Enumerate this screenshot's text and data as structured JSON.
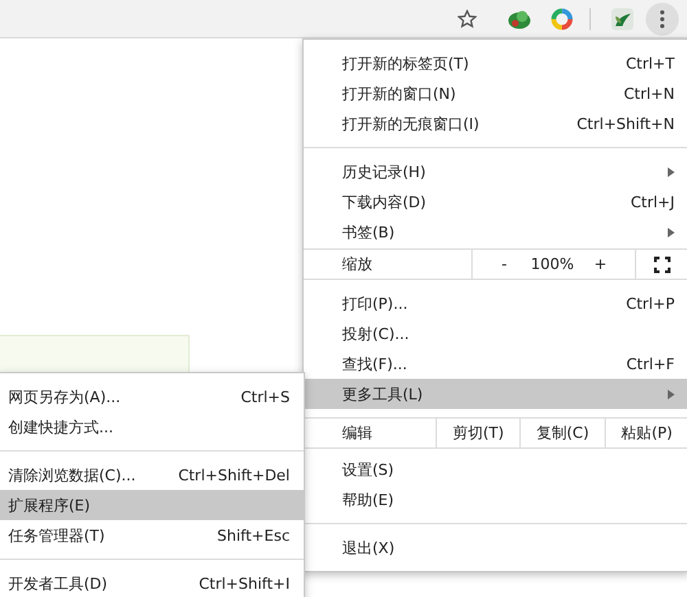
{
  "toolbar": {
    "icons": [
      {
        "kind": "star"
      },
      {
        "kind": "ext-green"
      },
      {
        "kind": "ext-ring"
      },
      {
        "kind": "ext-plant"
      },
      {
        "kind": "menu",
        "selected": true
      }
    ]
  },
  "menu": {
    "items": [
      {
        "kind": "item",
        "label": "打开新的标签页(T)",
        "shortcut": "Ctrl+T",
        "submenu": false,
        "selected": false
      },
      {
        "kind": "item",
        "label": "打开新的窗口(N)",
        "shortcut": "Ctrl+N",
        "submenu": false,
        "selected": false
      },
      {
        "kind": "item",
        "label": "打开新的无痕窗口(I)",
        "shortcut": "Ctrl+Shift+N",
        "submenu": false,
        "selected": false
      },
      {
        "kind": "separator"
      },
      {
        "kind": "item",
        "label": "历史记录(H)",
        "submenu": true,
        "selected": false
      },
      {
        "kind": "item",
        "label": "下载内容(D)",
        "shortcut": "Ctrl+J",
        "submenu": false,
        "selected": false
      },
      {
        "kind": "item",
        "label": "书签(B)",
        "submenu": true,
        "selected": false
      },
      {
        "kind": "zoom",
        "label": "缩放",
        "minus": "-",
        "value": "100%",
        "plus": "+"
      },
      {
        "kind": "item",
        "label": "打印(P)...",
        "shortcut": "Ctrl+P",
        "submenu": false,
        "selected": false
      },
      {
        "kind": "item",
        "label": "投射(C)...",
        "submenu": false,
        "selected": false
      },
      {
        "kind": "item",
        "label": "查找(F)...",
        "shortcut": "Ctrl+F",
        "submenu": false,
        "selected": false
      },
      {
        "kind": "item",
        "label": "更多工具(L)",
        "submenu": true,
        "selected": true
      },
      {
        "kind": "edit",
        "label": "编辑",
        "buttons": [
          "剪切(T)",
          "复制(C)",
          "粘贴(P)"
        ]
      },
      {
        "kind": "item",
        "label": "设置(S)",
        "submenu": false,
        "selected": false
      },
      {
        "kind": "item",
        "label": "帮助(E)",
        "submenu": false,
        "selected": false
      },
      {
        "kind": "separator"
      },
      {
        "kind": "item",
        "label": "退出(X)",
        "submenu": false,
        "selected": false
      }
    ]
  },
  "submenu": {
    "items": [
      {
        "kind": "item",
        "label": "网页另存为(A)...",
        "shortcut": "Ctrl+S",
        "selected": false
      },
      {
        "kind": "item",
        "label": "创建快捷方式...",
        "selected": false
      },
      {
        "kind": "separator"
      },
      {
        "kind": "item",
        "label": "清除浏览数据(C)...",
        "shortcut": "Ctrl+Shift+Del",
        "selected": false
      },
      {
        "kind": "item",
        "label": "扩展程序(E)",
        "selected": true
      },
      {
        "kind": "item",
        "label": "任务管理器(T)",
        "shortcut": "Shift+Esc",
        "selected": false
      },
      {
        "kind": "separator"
      },
      {
        "kind": "item",
        "label": "开发者工具(D)",
        "shortcut": "Ctrl+Shift+I",
        "selected": false
      }
    ]
  }
}
